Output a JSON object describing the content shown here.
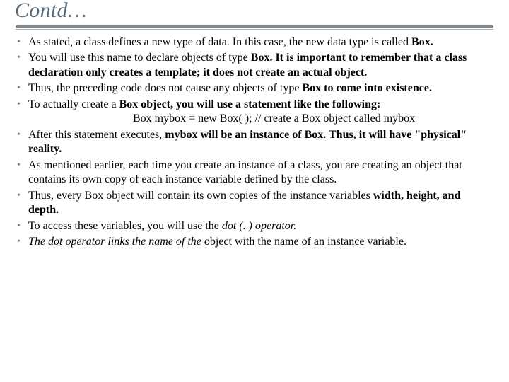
{
  "title": "Contd…",
  "bullets": {
    "b0_a": "As stated, a class defines a new type of data. In this case, the new data type is called ",
    "b0_b": "Box.",
    "b1_a": "You will use this name to declare objects of type ",
    "b1_b": "Box. It is important to remember that a class declaration only creates a template; it does not create an actual object.",
    "b2_a": "Thus, the preceding code does not cause any objects of type ",
    "b2_b": "Box to come into existence.",
    "b3_a": "To actually create a ",
    "b3_b": "Box object, you will use a statement like the following:",
    "code": "Box mybox = new Box( );   // create a Box object called mybox",
    "b4_a": "After this statement executes, ",
    "b4_b": "mybox will be an instance of Box. Thus, it will have \"physical\" reality.",
    "b5": "As mentioned earlier, each time you create an instance of a class, you are creating an object that contains its own copy of each instance variable defined by the class.",
    "b6_a": "Thus, every Box object will contain its own copies of the instance variables ",
    "b6_b": "width, height, and depth.",
    "b7_a": "To access these variables, you will use the ",
    "b7_b": "dot (. ) operator.",
    "b8_a": "The dot operator links the name of the",
    "b8_b": " object with the name of an instance variable."
  }
}
